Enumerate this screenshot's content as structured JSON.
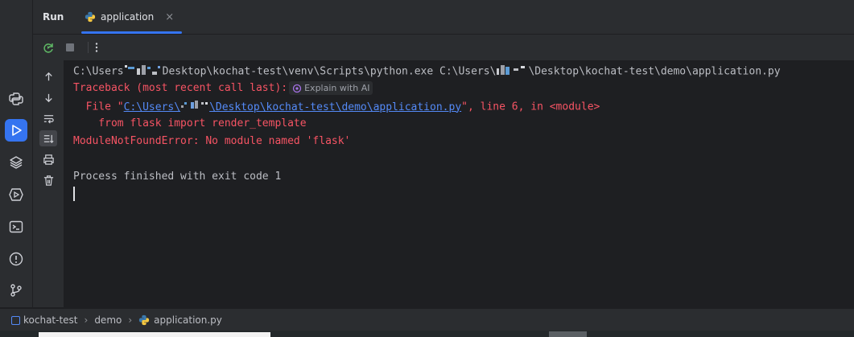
{
  "header": {
    "run_label": "Run",
    "tab_label": "application",
    "tab_close": "×"
  },
  "console": {
    "cmd_a": "C:\\Users",
    "cmd_b": "Desktop\\kochat-test\\venv\\Scripts\\python.exe C:\\Users\\",
    "cmd_c": "\\Desktop\\kochat-test\\demo\\application.py",
    "traceback": "Traceback (most recent call last):",
    "ai_chip": "Explain with AI",
    "file_prefix": "  File \"",
    "file_link_a": "C:\\Users\\",
    "file_link_b": "\\Desktop\\kochat-test\\demo\\application.py",
    "file_suffix": "\", line 6, in <module>",
    "import_line": "    from flask import render_template",
    "error_line": "ModuleNotFoundError: No module named 'flask'",
    "exit_line": "Process finished with exit code 1"
  },
  "status": {
    "crumb_project": "kochat-test",
    "crumb_folder": "demo",
    "crumb_file": "application.py",
    "separator": "›"
  },
  "icons": {
    "left_strip": [
      "python-packages-icon",
      "run-icon",
      "layers-icon",
      "services-icon",
      "terminal-icon",
      "problems-icon",
      "git-icon"
    ],
    "toolbar": [
      "rerun-icon",
      "stop-icon",
      "more-icon"
    ],
    "gutter": [
      "up-arrow-icon",
      "down-arrow-icon",
      "soft-wrap-icon",
      "scroll-to-end-icon",
      "print-icon",
      "trash-icon"
    ]
  },
  "colors": {
    "accent": "#3574f0",
    "error": "#f75464",
    "link": "#548af7",
    "text": "#bcbec4"
  }
}
